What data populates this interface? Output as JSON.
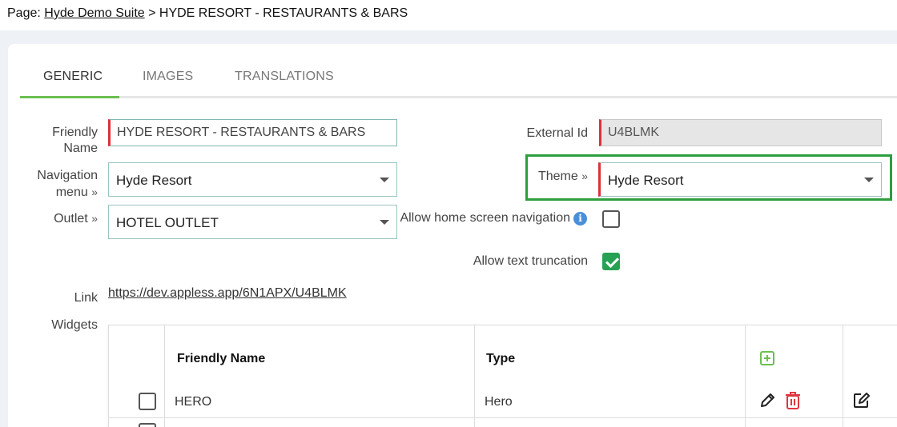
{
  "breadcrumb": {
    "prefix": "Page: ",
    "parent": "Hyde Demo Suite",
    "separator": " > ",
    "current": "HYDE RESORT - RESTAURANTS & BARS"
  },
  "tabs": [
    {
      "label": "GENERIC",
      "active": true
    },
    {
      "label": "IMAGES",
      "active": false
    },
    {
      "label": "TRANSLATIONS",
      "active": false
    }
  ],
  "form": {
    "friendly_name": {
      "label_line1": "Friendly",
      "label_line2": "Name",
      "value": "HYDE RESORT - RESTAURANTS & BARS"
    },
    "navigation_menu": {
      "label_line1": "Navigation",
      "label_line2": "menu",
      "value": "Hyde Resort"
    },
    "outlet": {
      "label": "Outlet",
      "value": "HOTEL OUTLET"
    },
    "external_id": {
      "label": "External Id",
      "value": "U4BLMK"
    },
    "theme": {
      "label": "Theme",
      "value": "Hyde Resort"
    },
    "allow_home_nav": {
      "label": "Allow home screen navigation",
      "checked": false
    },
    "allow_text_truncation": {
      "label": "Allow text truncation",
      "checked": true
    },
    "link": {
      "label": "Link",
      "value": "https://dev.appless.app/6N1APX/U4BLMK"
    },
    "widgets_label": "Widgets",
    "chevron": "»"
  },
  "widgets": {
    "columns": [
      "Friendly Name",
      "Type"
    ],
    "rows": [
      {
        "name": "HERO",
        "type": "Hero"
      }
    ]
  },
  "colors": {
    "accent_green": "#6cbf52",
    "highlight_green": "#2e9e3e",
    "required_red": "#d9323c",
    "delete_red": "#e0353f",
    "checkbox_green": "#27a153",
    "info_blue": "#4a8fd8"
  },
  "icons": {
    "add": "plus-square-icon",
    "edit": "pencil-icon",
    "delete": "trash-icon",
    "open": "edit-square-icon",
    "info": "info-icon"
  }
}
